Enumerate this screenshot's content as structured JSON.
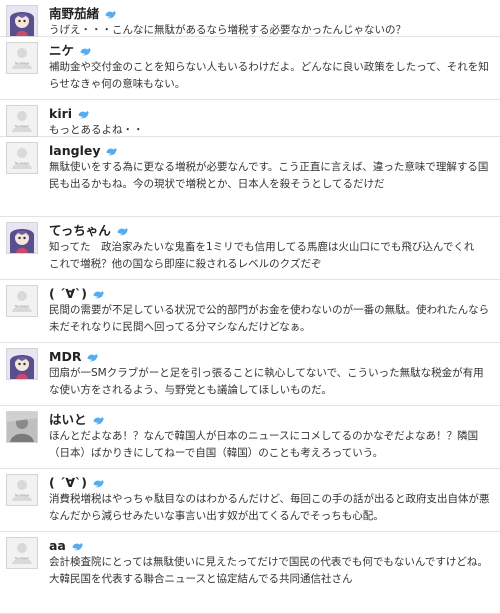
{
  "colors": {
    "bird": "#55acee",
    "divider": "#e3e3e3",
    "name": "#222222",
    "text": "#333333"
  },
  "avatars": {
    "placeholder_caption": "No Image",
    "placeholder_icon": "person-silhouette-icon"
  },
  "tweets": [
    {
      "name": "南野茄緒",
      "avatar": "anime-character-avatar",
      "text": "うげえ・・・こんなに無駄があるなら増税する必要なかったんじゃないの？"
    },
    {
      "name": "ニケ",
      "avatar": "placeholder",
      "text": "補助金や交付金のことを知らない人もいるわけだよ。どんなに良い政策をしたって、それを知らせなきゃ何の意味もない。"
    },
    {
      "name": "kiri",
      "avatar": "placeholder",
      "text": "もっとあるよね・・"
    },
    {
      "name": "langley",
      "avatar": "placeholder",
      "text": "無駄使いをする為に更なる増税が必要なんです。こう正直に言えば、違った意味で理解する国民も出るかもね。今の現状で増税とか、日本人を殺そうとしてるだけだ"
    },
    {
      "name": "てっちゃん",
      "avatar": "anime-character-avatar",
      "text": "知ってた　政治家みたいな鬼畜を1ミリでも信用してる馬鹿は火山口にでも飛び込んでくれ　これで増税？他の国なら即座に殺されるレベルのクズだぞ"
    },
    {
      "name": "( ´∀`)",
      "avatar": "placeholder",
      "text": "民間の需要が不足している状況で公的部門がお金を使わないのが一番の無駄。使われたんなら未だそれなりに民間へ回ってる分マシなんだけどなぁ。"
    },
    {
      "name": "MDR",
      "avatar": "anime-character-avatar",
      "text": "団扇が一SMクラブがーと足を引っ張ることに執心してないで、こういった無駄な税金が有用な使い方をされるよう、与野党とも議論してほしいものだ。"
    },
    {
      "name": "はいと",
      "avatar": "gray-photo-avatar",
      "text": "ほんとだよなあ！？なんで韓国人が日本のニュースにコメしてるのかなぞだよなあ！？隣国（日本）ばかりきにしてねーで自国（韓国）のことも考えろっていう。"
    },
    {
      "name": "( ´∀`)",
      "avatar": "placeholder",
      "text": "消費税増税はやっちゃ駄目なのはわかるんだけど、毎回この手の話が出ると政府支出自体が悪なんだから減らせみたいな事言い出す奴が出てくるんでそっちも心配。"
    },
    {
      "name": "aa",
      "avatar": "placeholder",
      "text": "会計検査院にとっては無駄使いに見えたってだけで国民の代表でも何でもないんですけどね。大韓民国を代表する聯合ニュースと協定結んでる共同通信社さん"
    }
  ]
}
